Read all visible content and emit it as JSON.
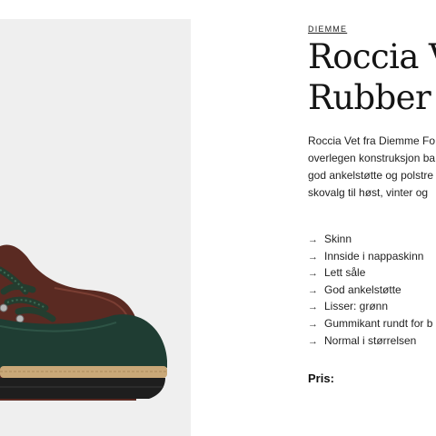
{
  "product": {
    "brand": "DIEMME",
    "title_lines": [
      "Roccia Ve",
      "Rubber –"
    ],
    "description_lines": [
      "Roccia Vet fra Diemme Fo",
      "overlegen konstruksjon ba",
      "god ankelstøtte og polstre",
      "skovalg til høst, vinter og"
    ],
    "features": [
      "Skinn",
      "Innside i nappaskinn",
      "Lett såle",
      "God ankelstøtte",
      "Lisser: grønn",
      "Gummikant rundt for b",
      "Normal i størrelsen"
    ],
    "feature_arrow": "→",
    "price_label": "Pris:"
  },
  "image": {
    "icon": "boot-product-photo",
    "colors": {
      "background": "#efefef",
      "leather": "#5a2a22",
      "rubber": "#1f3d33",
      "midsole": "#c9a878",
      "sole": "#1e1e1e"
    }
  }
}
